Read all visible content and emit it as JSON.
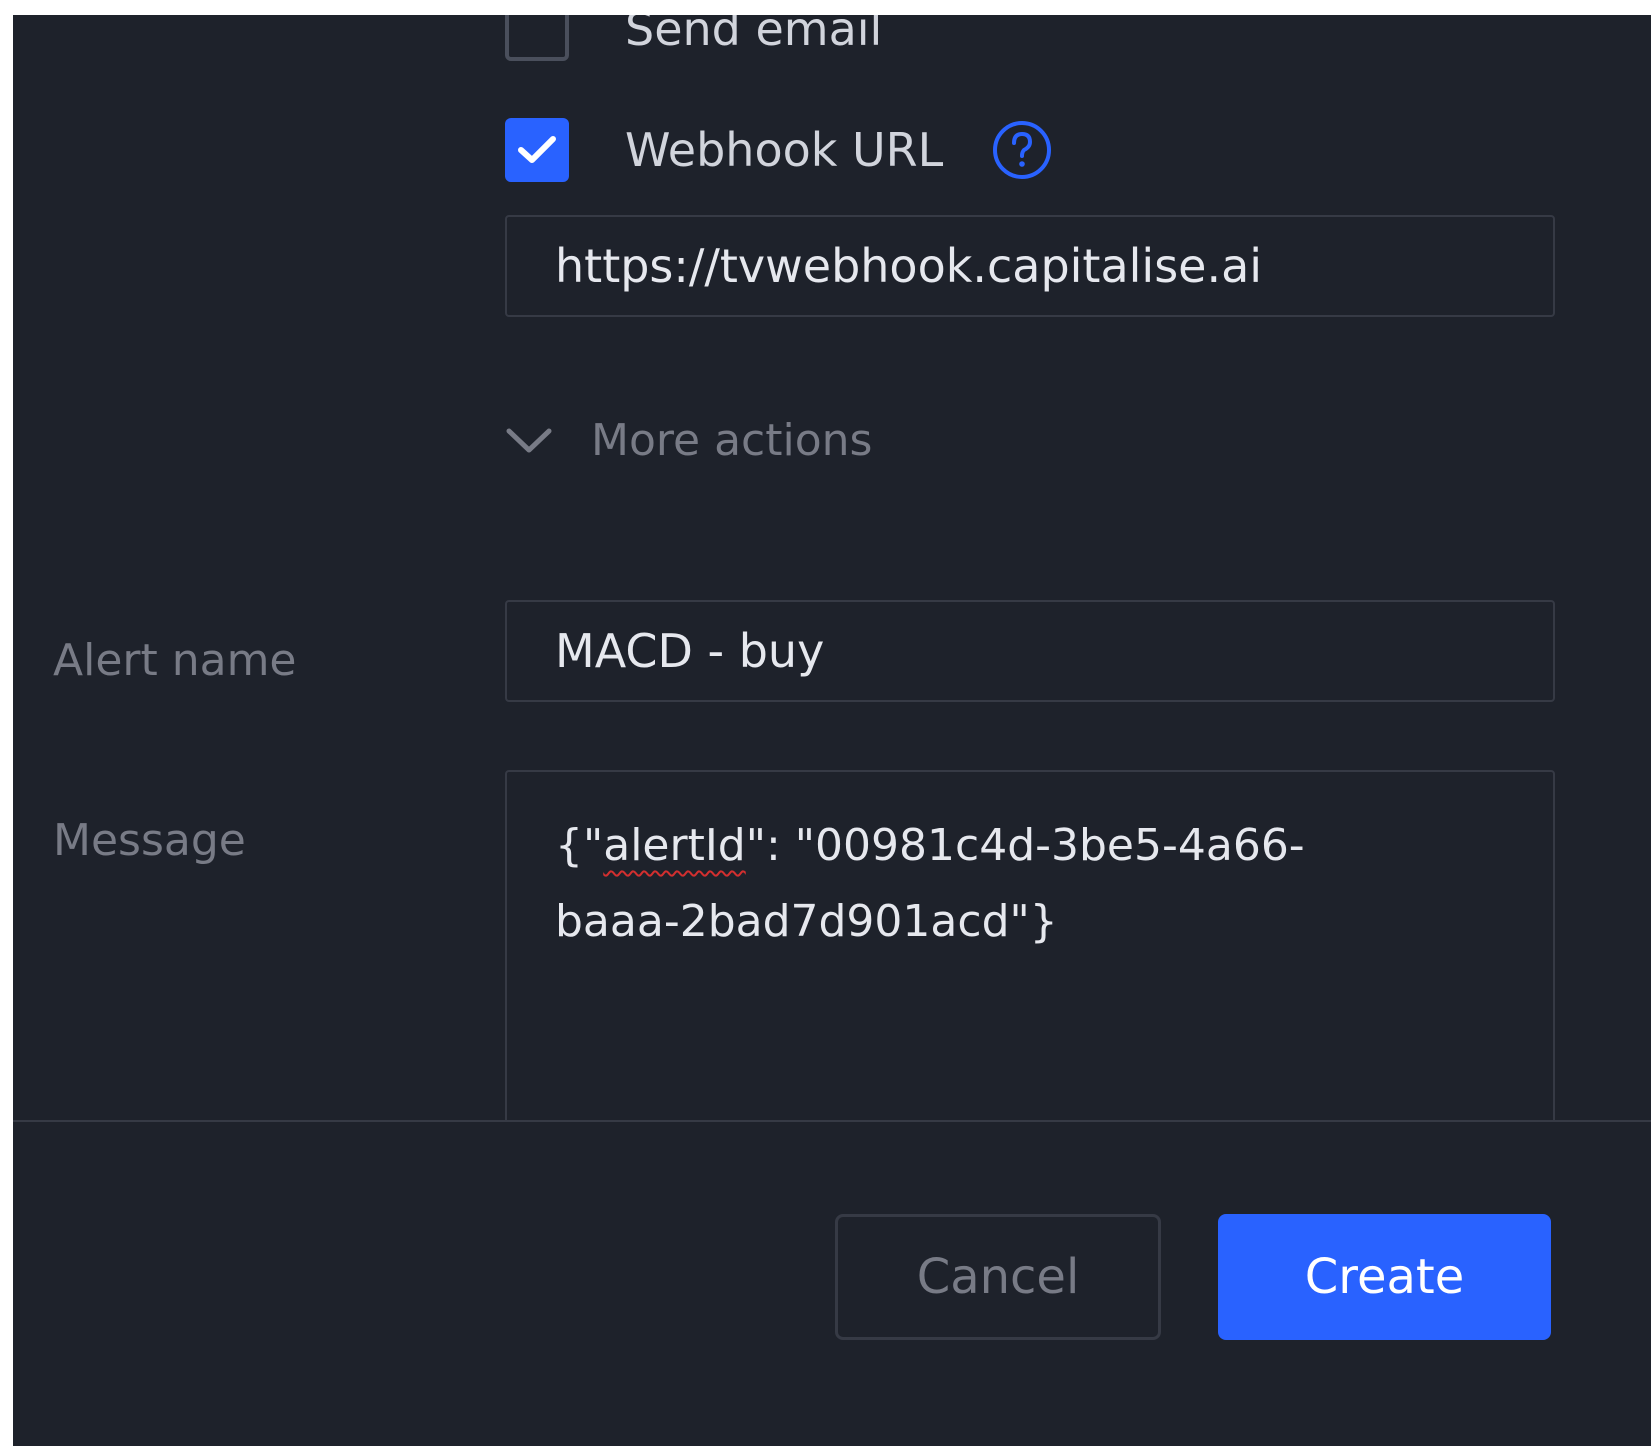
{
  "notifications": {
    "send_email": {
      "label": "Send email",
      "checked": false
    },
    "webhook": {
      "label": "Webhook URL",
      "checked": true,
      "help_icon": "question-circle-icon"
    },
    "webhook_url_value": "https://tvwebhook.capitalise.ai"
  },
  "more_actions": {
    "label": "More actions",
    "icon": "chevron-down-icon"
  },
  "alert_name": {
    "label": "Alert name",
    "value": "MACD - buy"
  },
  "message": {
    "label": "Message",
    "line1_prefix": "{\"",
    "line1_word": "alertId",
    "line1_suffix": "\": \"00981c4d-3be5-4a66-",
    "line2": "baaa-2bad7d901acd\"}"
  },
  "footer": {
    "cancel_label": "Cancel",
    "create_label": "Create"
  },
  "colors": {
    "background": "#1e222b",
    "accent": "#2962ff",
    "border": "#363a45",
    "muted_text": "#787b86"
  }
}
